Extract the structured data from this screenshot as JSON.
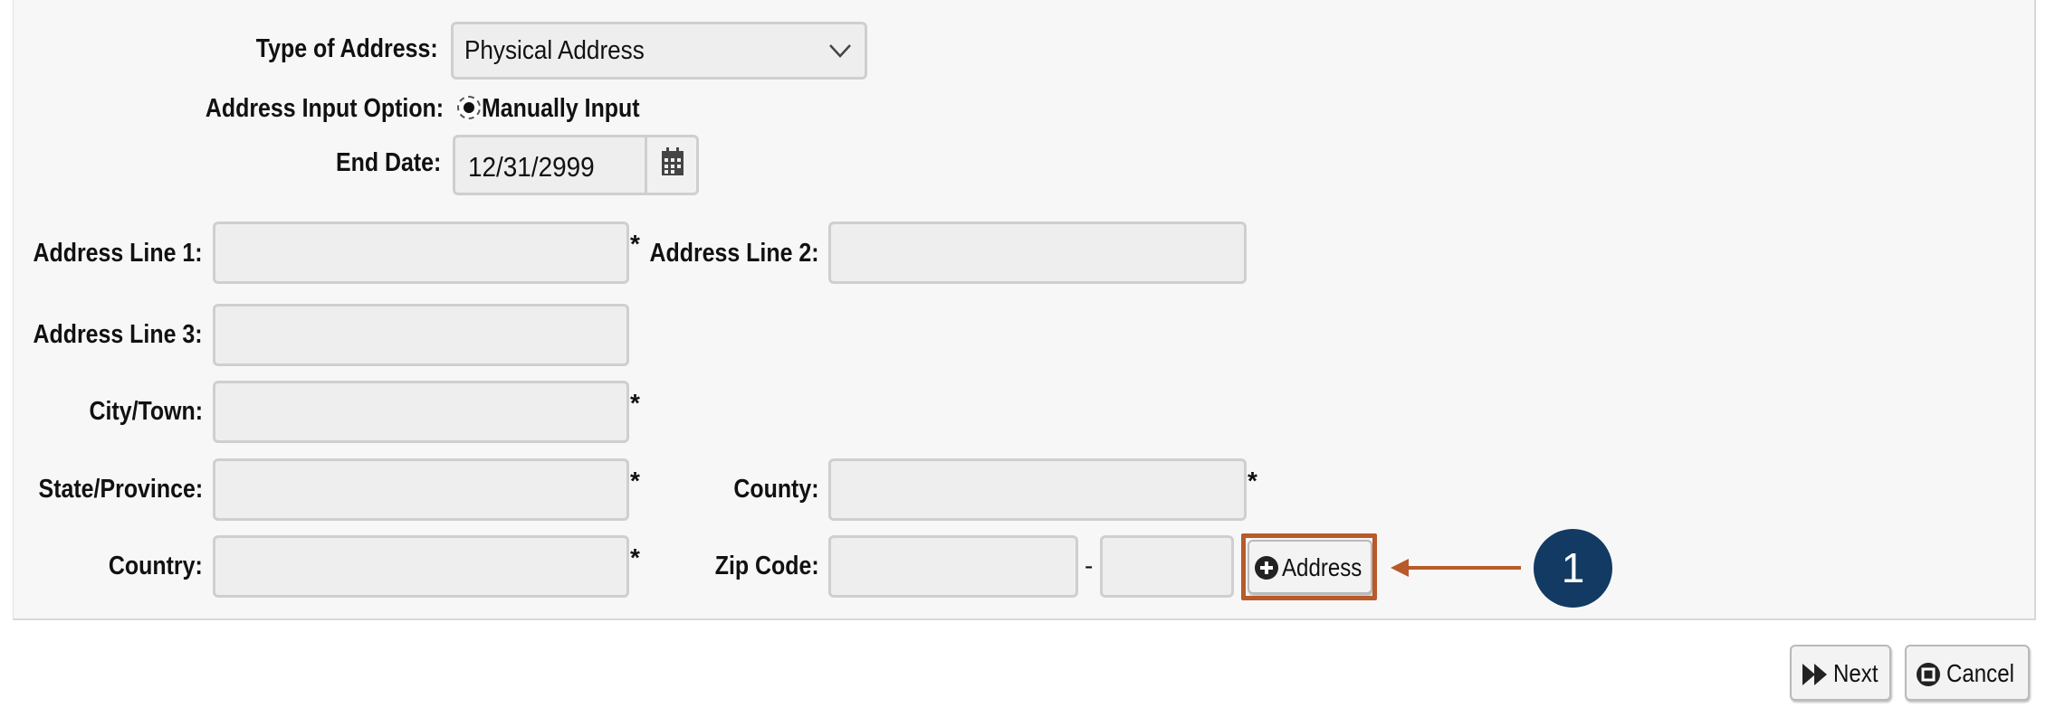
{
  "form": {
    "type_label": "Type of Address:",
    "type_value": "Physical Address",
    "input_option_label": "Address Input Option:",
    "input_option_value": "Manually Input",
    "end_date_label": "End Date:",
    "end_date_value": "12/31/2999",
    "address1_label": "Address Line 1:",
    "address2_label": "Address Line 2:",
    "address3_label": "Address Line 3:",
    "city_label": "City/Town:",
    "state_label": "State/Province:",
    "county_label": "County:",
    "country_label": "Country:",
    "zip_label": "Zip Code:",
    "zip_separator": "-",
    "required_marker": "*",
    "add_address_label": "Address"
  },
  "footer": {
    "next_label": "Next",
    "cancel_label": "Cancel"
  },
  "annotation": {
    "callout_number": "1",
    "color": "#b85a2b",
    "badge_color": "#123a63"
  },
  "icons": {
    "dropdown": "chevron-down-icon",
    "calendar": "calendar-icon",
    "add": "plus-circle-icon",
    "next": "fast-forward-icon",
    "cancel": "close-circle-icon"
  }
}
